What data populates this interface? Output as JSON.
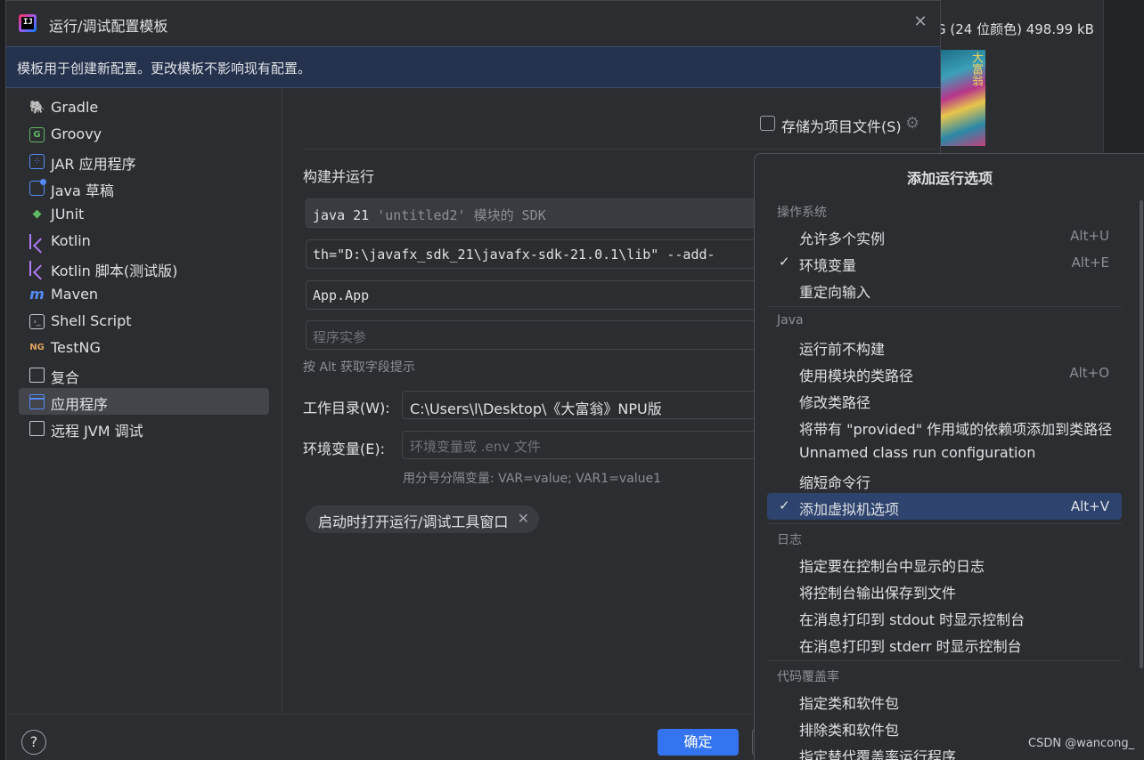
{
  "background": {
    "file_info": "G (24 位颜色) 498.99 kB",
    "thumb_text": "大富翁"
  },
  "dialog": {
    "title": "运行/调试配置模板",
    "banner": "模板用于创建新配置。更改模板不影响现有配置。",
    "sidebar": [
      {
        "label": "Gradle",
        "icon": "gradle-icon",
        "selected": false
      },
      {
        "label": "Groovy",
        "icon": "groovy-icon",
        "selected": false
      },
      {
        "label": "JAR 应用程序",
        "icon": "jar-icon",
        "selected": false
      },
      {
        "label": "Java 草稿",
        "icon": "java-scratch-icon",
        "selected": false
      },
      {
        "label": "JUnit",
        "icon": "junit-icon",
        "selected": false
      },
      {
        "label": "Kotlin",
        "icon": "kotlin-icon",
        "selected": false
      },
      {
        "label": "Kotlin 脚本(测试版)",
        "icon": "kotlin-script-icon",
        "selected": false
      },
      {
        "label": "Maven",
        "icon": "maven-icon",
        "selected": false
      },
      {
        "label": "Shell Script",
        "icon": "shell-icon",
        "selected": false
      },
      {
        "label": "TestNG",
        "icon": "testng-icon",
        "selected": false
      },
      {
        "label": "复合",
        "icon": "compound-icon",
        "selected": false
      },
      {
        "label": "应用程序",
        "icon": "application-icon",
        "selected": true
      },
      {
        "label": "远程 JVM 调试",
        "icon": "remote-jvm-icon",
        "selected": false
      }
    ],
    "store_as_project_file": "存储为项目文件(S)",
    "section_title": "构建并运行",
    "jre": {
      "main": "java 21",
      "muted": "'untitled2' 模块的 SDK"
    },
    "vm_options": "th=\"D:\\javafx_sdk_21\\javafx-sdk-21.0.1\\lib\" --add-",
    "main_class": "App.App",
    "program_args_placeholder": "程序实参",
    "hint": "按 Alt 获取字段提示",
    "working_dir_label": "工作目录(W):",
    "working_dir_value": "C:\\Users\\l\\Desktop\\《大富翁》NPU版",
    "env_label": "环境变量(E):",
    "env_placeholder": "环境变量或 .env 文件",
    "env_hint": "用分号分隔变量: VAR=value; VAR1=value1",
    "chip_label": "启动时打开运行/调试工具窗口",
    "help": "?",
    "ok": "确定"
  },
  "popup": {
    "title": "添加运行选项",
    "groups": [
      {
        "name": "操作系统",
        "items": [
          {
            "label": "允许多个实例",
            "key": "Alt+U",
            "checked": false,
            "highlighted": false
          },
          {
            "label": "环境变量",
            "key": "Alt+E",
            "checked": true,
            "highlighted": false
          },
          {
            "label": "重定向输入",
            "key": "",
            "checked": false,
            "highlighted": false
          }
        ]
      },
      {
        "name": "Java",
        "items": [
          {
            "label": "运行前不构建",
            "key": "",
            "checked": false,
            "highlighted": false
          },
          {
            "label": "使用模块的类路径",
            "key": "Alt+O",
            "checked": false,
            "highlighted": false
          },
          {
            "label": "修改类路径",
            "key": "",
            "checked": false,
            "highlighted": false
          },
          {
            "label": "将带有 \"provided\" 作用域的依赖项添加到类路径",
            "key": "",
            "checked": false,
            "highlighted": false
          },
          {
            "label": "Unnamed class run configuration",
            "key": "",
            "checked": false,
            "highlighted": false
          },
          {
            "label": "缩短命令行",
            "key": "",
            "checked": false,
            "highlighted": false
          },
          {
            "label": "添加虚拟机选项",
            "key": "Alt+V",
            "checked": true,
            "highlighted": true
          }
        ]
      },
      {
        "name": "日志",
        "items": [
          {
            "label": "指定要在控制台中显示的日志",
            "key": "",
            "checked": false,
            "highlighted": false
          },
          {
            "label": "将控制台输出保存到文件",
            "key": "",
            "checked": false,
            "highlighted": false
          },
          {
            "label": "在消息打印到 stdout 时显示控制台",
            "key": "",
            "checked": false,
            "highlighted": false
          },
          {
            "label": "在消息打印到 stderr 时显示控制台",
            "key": "",
            "checked": false,
            "highlighted": false
          }
        ]
      },
      {
        "name": "代码覆盖率",
        "items": [
          {
            "label": "指定类和软件包",
            "key": "",
            "checked": false,
            "highlighted": false
          },
          {
            "label": "排除类和软件包",
            "key": "",
            "checked": false,
            "highlighted": false
          },
          {
            "label": "指定替代覆盖率运行程序",
            "key": "",
            "checked": false,
            "highlighted": false
          }
        ]
      }
    ]
  },
  "watermark": "CSDN @wancong_"
}
